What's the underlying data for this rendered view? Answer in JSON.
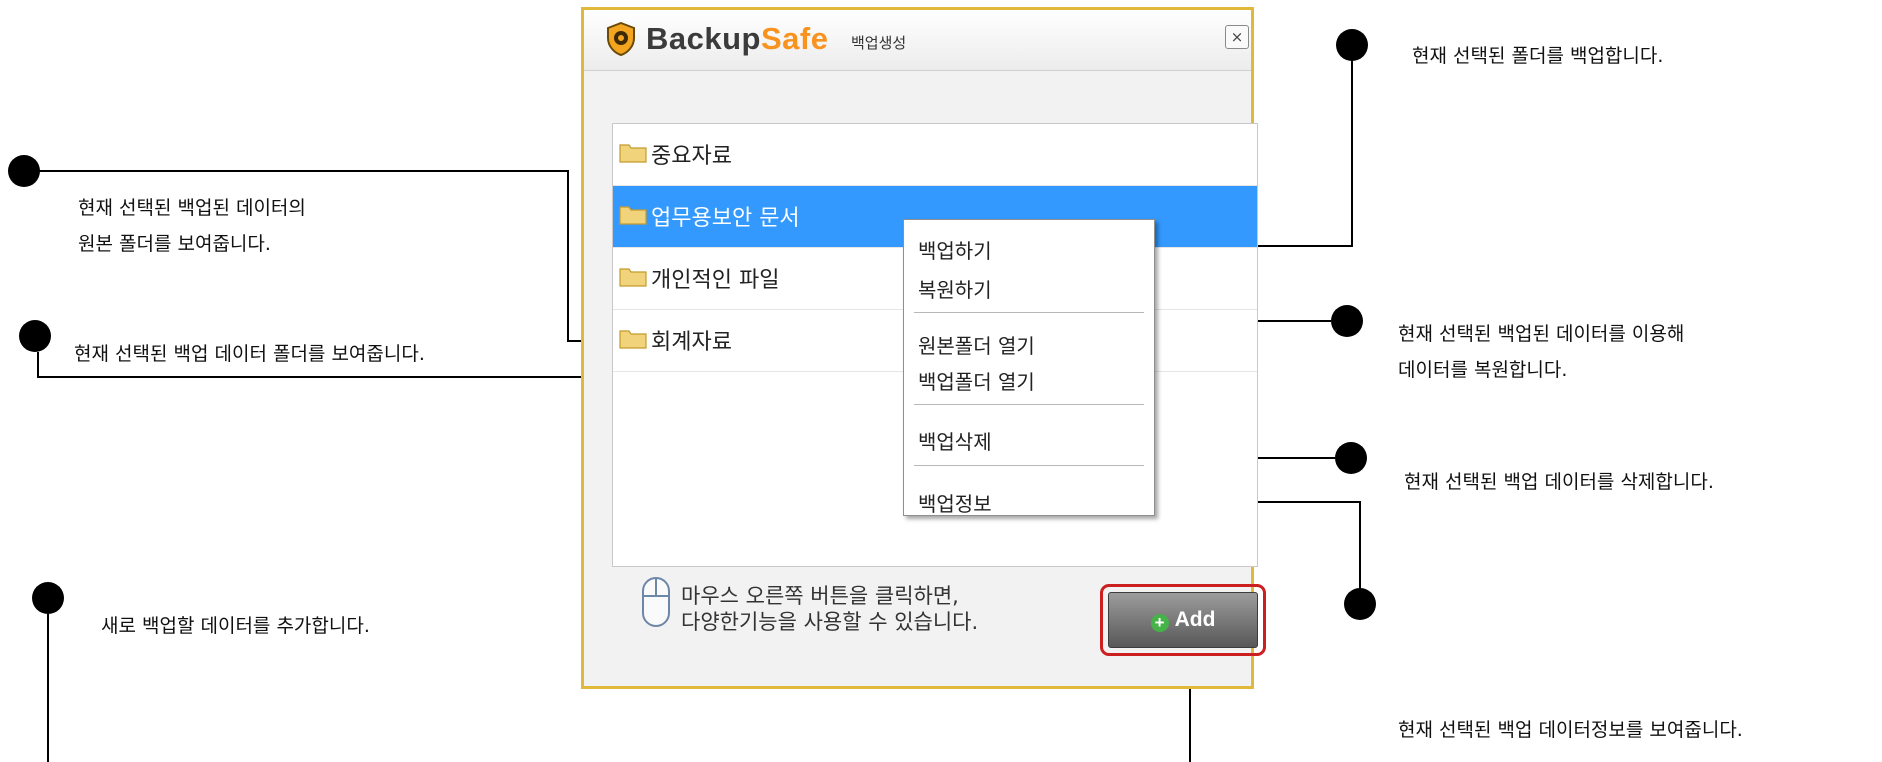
{
  "window": {
    "brand_part_1": "Backup",
    "brand_part_2": "Safe",
    "subtitle": "백업생성",
    "close_label": "×"
  },
  "folders": [
    {
      "label": "중요자료",
      "selected": false
    },
    {
      "label": "업무용보안 문서",
      "selected": true
    },
    {
      "label": "개인적인 파일",
      "selected": false
    },
    {
      "label": "회계자료",
      "selected": false
    }
  ],
  "context_menu": {
    "items": [
      "백업하기",
      "복원하기",
      "원본폴더 열기",
      "백업폴더 열기",
      "백업삭제",
      "백업정보"
    ]
  },
  "hint": {
    "line1": "마우스 오른쪽 버튼을 클릭하면,",
    "line2": "다양한기능을 사용할 수 있습니다."
  },
  "add_button": {
    "label": "Add"
  },
  "callouts": {
    "original_folder": {
      "line1": "현재 선택된 백업된 데이터의",
      "line2": "원본 폴더를 보여줍니다."
    },
    "backup_folder": "현재 선택된 백업 데이터 폴더를 보여줍니다.",
    "add_data": "새로 백업할 데이터를 추가합니다.",
    "backup": "현재 선택된 폴더를 백업합니다.",
    "restore": {
      "line1": "현재 선택된 백업된 데이터를 이용해",
      "line2": "데이터를 복원합니다."
    },
    "delete": "현재 선택된 백업 데이터를 삭제합니다.",
    "info": "현재 선택된 백업 데이터정보를 보여줍니다."
  },
  "colors": {
    "window_border": "#e2b83a",
    "selection": "#3399ff",
    "brand_accent": "#f7931e",
    "highlight_outline": "#cc1f1f"
  }
}
